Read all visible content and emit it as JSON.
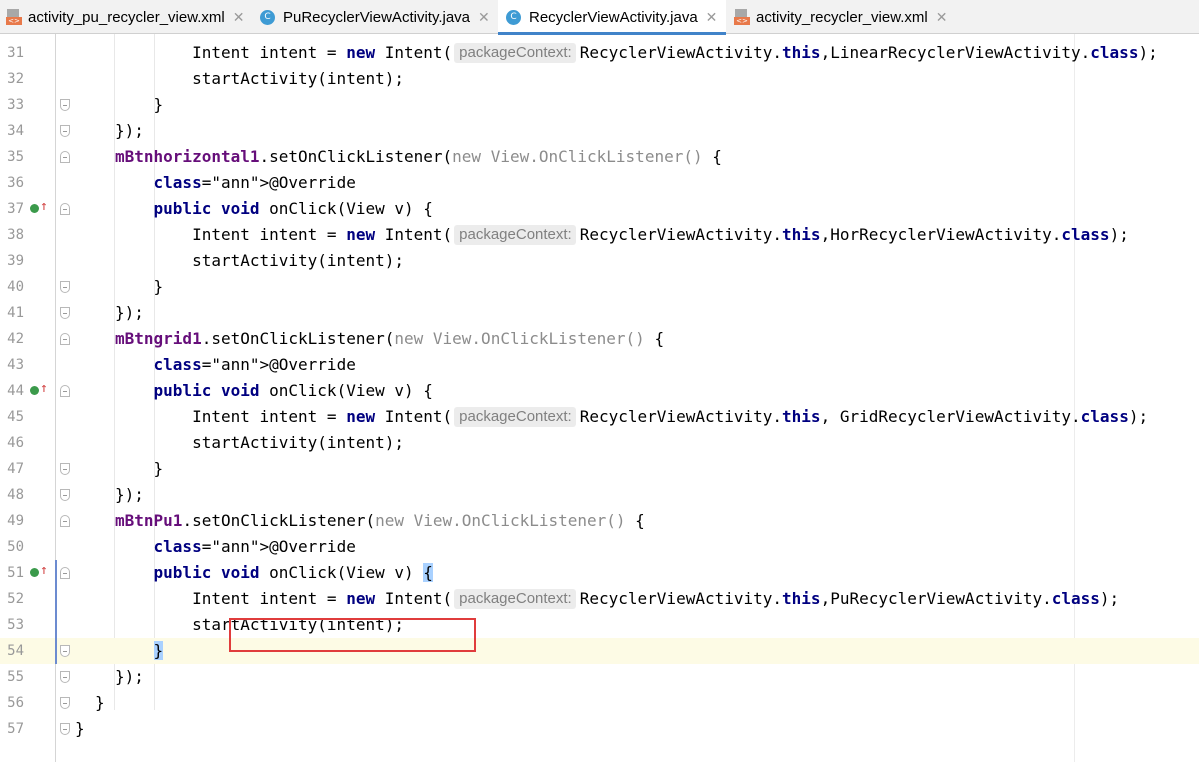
{
  "tabs": [
    {
      "label": "activity_pu_recycler_view.xml",
      "icon": "xml-file-icon"
    },
    {
      "label": "PuRecyclerViewActivity.java",
      "icon": "class-icon"
    },
    {
      "label": "RecyclerViewActivity.java",
      "icon": "class-icon",
      "active": true
    },
    {
      "label": "activity_recycler_view.xml",
      "icon": "xml-file-icon"
    }
  ],
  "hint_label": "packageContext:",
  "highlighted_line": 53,
  "current_line": 54,
  "lines": [
    {
      "n": "31",
      "pre": "        Intent intent = new Intent(",
      "post": "RecyclerViewActivity.this,LinearRecyclerViewActivity.class);"
    },
    {
      "n": "32",
      "text": "        startActivity(intent);"
    },
    {
      "n": "33",
      "text": "    }"
    },
    {
      "n": "34",
      "text": "});"
    },
    {
      "n": "35",
      "text": "mBtnhorizontal1.setOnClickListener(new View.OnClickListener() {"
    },
    {
      "n": "36",
      "text": "    @Override"
    },
    {
      "n": "37",
      "text": "    public void onClick(View v) {"
    },
    {
      "n": "38",
      "pre": "        Intent intent = new Intent(",
      "post": "RecyclerViewActivity.this,HorRecyclerViewActivity.class);"
    },
    {
      "n": "39",
      "text": "        startActivity(intent);"
    },
    {
      "n": "40",
      "text": "    }"
    },
    {
      "n": "41",
      "text": "});"
    },
    {
      "n": "42",
      "text": "mBtngrid1.setOnClickListener(new View.OnClickListener() {"
    },
    {
      "n": "43",
      "text": "    @Override"
    },
    {
      "n": "44",
      "text": "    public void onClick(View v) {"
    },
    {
      "n": "45",
      "pre": "        Intent intent = new Intent(",
      "post": "RecyclerViewActivity.this, GridRecyclerViewActivity.class);"
    },
    {
      "n": "46",
      "text": "        startActivity(intent);"
    },
    {
      "n": "47",
      "text": "    }"
    },
    {
      "n": "48",
      "text": "});"
    },
    {
      "n": "49",
      "text": "mBtnPu1.setOnClickListener(new View.OnClickListener() {"
    },
    {
      "n": "50",
      "text": "    @Override"
    },
    {
      "n": "51",
      "text": "    public void onClick(View v) {"
    },
    {
      "n": "52",
      "pre": "        Intent intent = new Intent(",
      "post": "RecyclerViewActivity.this,PuRecyclerViewActivity.class);"
    },
    {
      "n": "53",
      "text": "        startActivity(intent);"
    },
    {
      "n": "54",
      "text": "    }"
    },
    {
      "n": "55",
      "text": "});"
    },
    {
      "n": "56",
      "text": "}"
    },
    {
      "n": "57",
      "text": "}"
    }
  ]
}
